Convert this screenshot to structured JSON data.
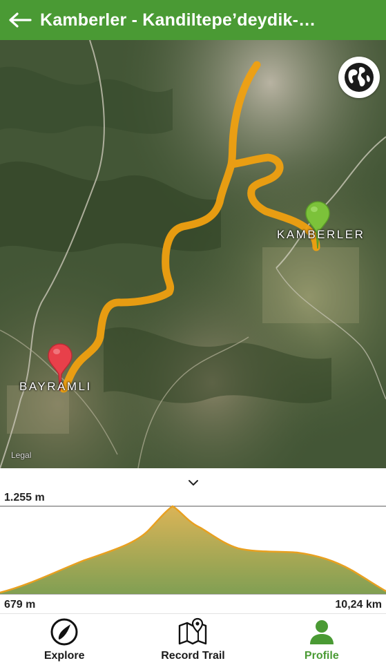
{
  "header": {
    "title": "Kamberler - Kandiltepe’deydik-…",
    "back_icon": "arrow-left-icon"
  },
  "map": {
    "labels": {
      "start_village": "KAMBERLER",
      "end_village": "BAYRAMLI",
      "legal": "Legal"
    },
    "globe_icon": "globe-icon",
    "colors": {
      "trail": "#f0a010",
      "start_pin": "#7cc23a",
      "end_pin": "#e8404a"
    }
  },
  "elevation_profile": {
    "max_label": "1.255 m",
    "min_label": "679 m",
    "distance_label": "10,24 km",
    "collapse_icon": "chevron-down-icon",
    "colors": {
      "line": "#e8a020",
      "fill_top": "#d9b04e",
      "fill_bottom": "#7a9a4a"
    }
  },
  "tabbar": {
    "tabs": [
      {
        "label": "Explore",
        "icon": "compass-icon",
        "active": false
      },
      {
        "label": "Record Trail",
        "icon": "map-pin-icon",
        "active": false
      },
      {
        "label": "Profile",
        "icon": "user-icon",
        "active": true
      }
    ],
    "active_color": "#4a9a34"
  }
}
